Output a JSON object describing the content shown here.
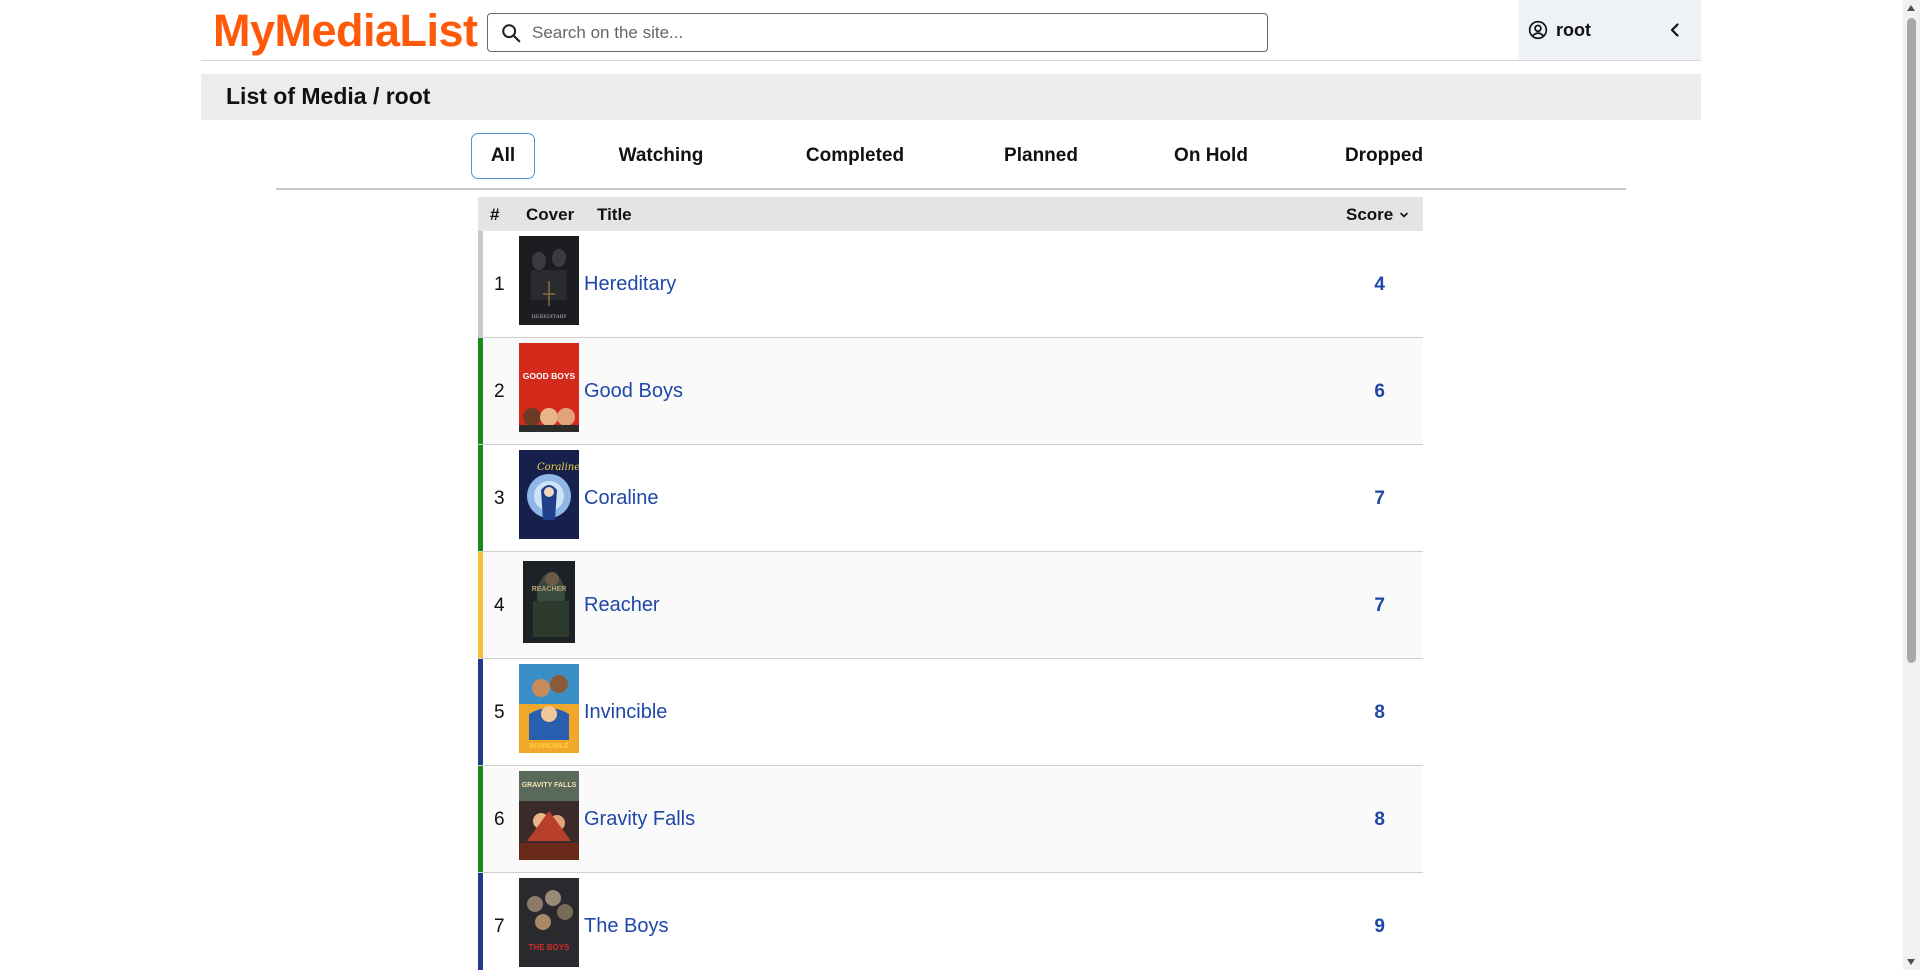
{
  "header": {
    "logo": "MyMediaList",
    "search_placeholder": "Search on the site...",
    "user_name": "root"
  },
  "page_title": "List of Media / root",
  "tabs": [
    {
      "label": "All",
      "active": true
    },
    {
      "label": "Watching",
      "active": false
    },
    {
      "label": "Completed",
      "active": false
    },
    {
      "label": "Planned",
      "active": false
    },
    {
      "label": "On Hold",
      "active": false
    },
    {
      "label": "Dropped",
      "active": false
    }
  ],
  "table": {
    "columns": {
      "rank": "#",
      "cover": "Cover",
      "title": "Title",
      "score": "Score"
    },
    "rows": [
      {
        "rank": "1",
        "title": "Hereditary",
        "score": "4",
        "status_color": "#c8c8c8",
        "cover_text": "HEREDITARY"
      },
      {
        "rank": "2",
        "title": "Good Boys",
        "score": "6",
        "status_color": "#1a8a1a",
        "cover_text": "GOOD BOYS"
      },
      {
        "rank": "3",
        "title": "Coraline",
        "score": "7",
        "status_color": "#1a8a1a",
        "cover_text": "Coraline"
      },
      {
        "rank": "4",
        "title": "Reacher",
        "score": "7",
        "status_color": "#f2c23a",
        "cover_text": "REACHER"
      },
      {
        "rank": "5",
        "title": "Invincible",
        "score": "8",
        "status_color": "#1f3b8c",
        "cover_text": "INVINCIBLE"
      },
      {
        "rank": "6",
        "title": "Gravity Falls",
        "score": "8",
        "status_color": "#1a8a1a",
        "cover_text": "GRAVITY FALLS"
      },
      {
        "rank": "7",
        "title": "The Boys",
        "score": "9",
        "status_color": "#1f3b8c",
        "cover_text": "THE BOYS"
      }
    ]
  },
  "colors": {
    "logo": "#ff5a0a",
    "link": "#1f47a8",
    "completed": "#1a8a1a",
    "watching": "#1f3b8c",
    "on_hold": "#f2c23a",
    "planned": "#c8c8c8"
  }
}
